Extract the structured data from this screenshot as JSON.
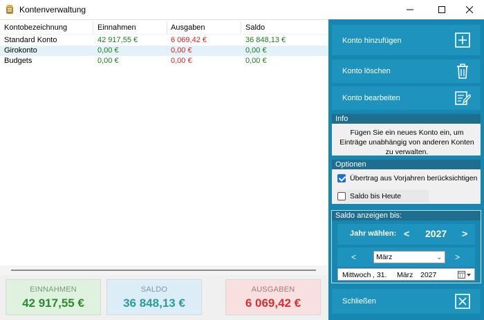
{
  "window": {
    "title": "Kontenverwaltung"
  },
  "table": {
    "columns": [
      "Kontobezeichnung",
      "Einnahmen",
      "Ausgaben",
      "Saldo"
    ],
    "rows": [
      {
        "name": "Standard Konto",
        "einnahmen": "42 917,55 €",
        "ausgaben": "6 069,42 €",
        "saldo": "36 848,13 €"
      },
      {
        "name": "Girokonto",
        "einnahmen": "0,00 €",
        "ausgaben": "0,00 €",
        "saldo": "0,00 €"
      },
      {
        "name": "Budgets",
        "einnahmen": "0,00 €",
        "ausgaben": "0,00 €",
        "saldo": "0,00 €"
      }
    ],
    "selected_row": 1
  },
  "summary": {
    "einnahmen_label": "EINNAHMEN",
    "einnahmen_value": "42 917,55 €",
    "saldo_label": "SALDO",
    "saldo_value": "36 848,13 €",
    "ausgaben_label": "AUSGABEN",
    "ausgaben_value": "6 069,42 €"
  },
  "panel": {
    "add_label": "Konto hinzufügen",
    "delete_label": "Konto löschen",
    "edit_label": "Konto bearbeiten",
    "close_label": "Schließen",
    "info": {
      "title": "Info",
      "text": "Fügen Sie ein neues Konto ein, um Einträge unabhängig von anderen Konten zu verwalten."
    },
    "options": {
      "title": "Optionen",
      "carry_over_label": "Übertrag aus Vorjahren berücksichtigen",
      "carry_over_checked": true,
      "saldo_today_label": "Saldo bis Heute",
      "saldo_today_checked": false
    },
    "saldo_display": {
      "title": "Saldo anzeigen bis:",
      "year_label": "Jahr wählen:",
      "year_prev": "<",
      "year_value": "2027",
      "year_next": ">",
      "month_prev": "<",
      "month_value": "März",
      "month_next": ">",
      "date_weekday": "Mittwoch",
      "date_day": ", 31.",
      "date_month": "März",
      "date_year": "2027"
    }
  },
  "colors": {
    "panel_bg": "#1786b0",
    "button_bg": "#1e93bd",
    "income": "#2b8a2b",
    "expense": "#d43030",
    "balance": "#2a9c9a"
  }
}
